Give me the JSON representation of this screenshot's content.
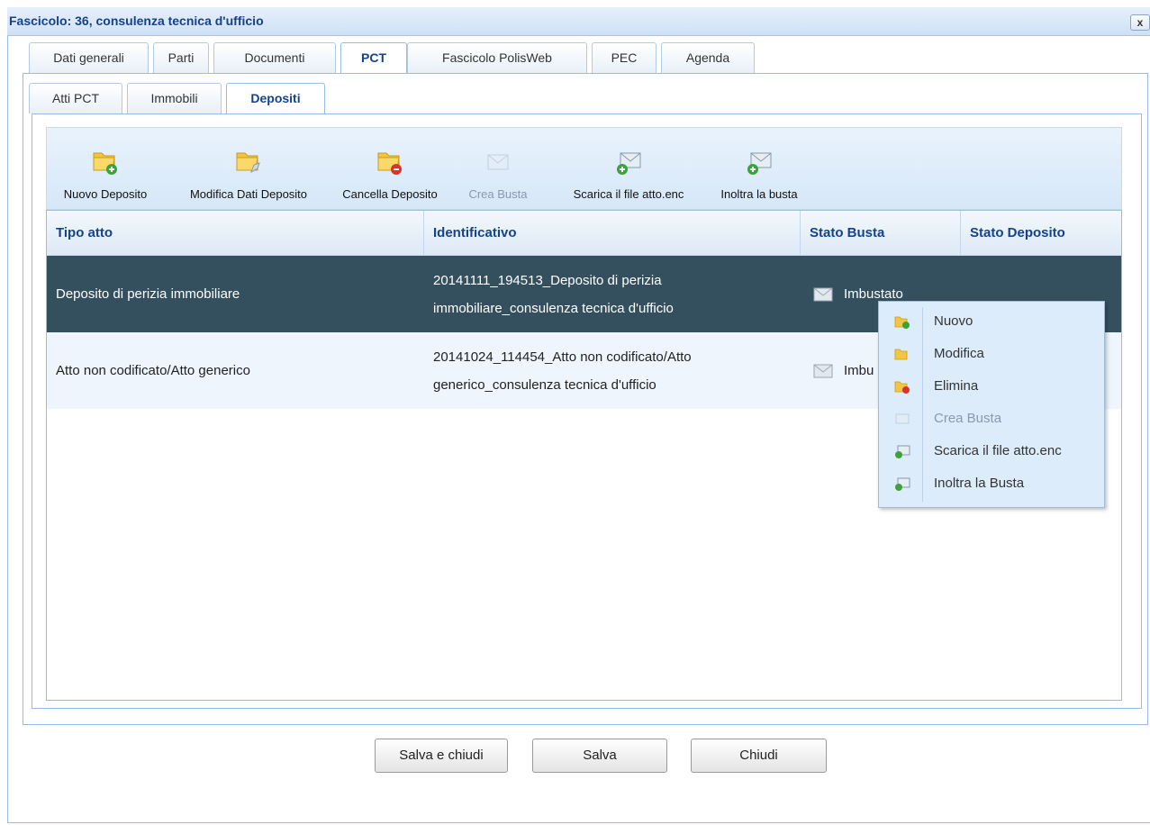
{
  "window": {
    "title": "Fascicolo: 36, consulenza tecnica d'ufficio",
    "close_label": "x"
  },
  "tabs": [
    {
      "label": "Dati generali",
      "active": false
    },
    {
      "label": "Parti",
      "active": false
    },
    {
      "label": "Documenti",
      "active": false
    },
    {
      "label": "PCT",
      "active": true
    },
    {
      "label": "Fascicolo PolisWeb",
      "active": false
    },
    {
      "label": "PEC",
      "active": false
    },
    {
      "label": "Agenda",
      "active": false
    }
  ],
  "subtabs": [
    {
      "label": "Atti PCT",
      "active": false
    },
    {
      "label": "Immobili",
      "active": false
    },
    {
      "label": "Depositi",
      "active": true
    }
  ],
  "toolbar": [
    {
      "label": "Nuovo Deposito",
      "icon": "folder-add-icon",
      "enabled": true
    },
    {
      "label": "Modifica Dati Deposito",
      "icon": "folder-edit-icon",
      "enabled": true
    },
    {
      "label": "Cancella Deposito",
      "icon": "folder-delete-icon",
      "enabled": true
    },
    {
      "label": "Crea Busta",
      "icon": "envelope-icon",
      "enabled": false
    },
    {
      "label": "Scarica il file atto.enc",
      "icon": "envelope-download-icon",
      "enabled": true
    },
    {
      "label": "Inoltra la busta",
      "icon": "envelope-send-icon",
      "enabled": true
    }
  ],
  "grid": {
    "columns": [
      "Tipo atto",
      "Identificativo",
      "Stato Busta",
      "Stato Deposito"
    ],
    "rows": [
      {
        "tipo_atto": "Deposito di perizia immobiliare",
        "identificativo_1": "20141111_194513_Deposito di perizia",
        "identificativo_2": "immobiliare_consulenza tecnica d'ufficio",
        "stato_busta": "Imbustato",
        "stato_deposito": "",
        "selected": true
      },
      {
        "tipo_atto": "Atto non codificato/Atto generico",
        "identificativo_1": "20141024_114454_Atto non codificato/Atto",
        "identificativo_2": "generico_consulenza tecnica d'ufficio",
        "stato_busta": "Imbu",
        "stato_deposito": "",
        "selected": false
      }
    ]
  },
  "context_menu": [
    {
      "label": "Nuovo",
      "icon": "folder-add-icon",
      "enabled": true
    },
    {
      "label": "Modifica",
      "icon": "folder-edit-icon",
      "enabled": true
    },
    {
      "label": "Elimina",
      "icon": "folder-delete-icon",
      "enabled": true
    },
    {
      "label": "Crea Busta",
      "icon": "envelope-icon",
      "enabled": false
    },
    {
      "label": "Scarica il file atto.enc",
      "icon": "envelope-download-icon",
      "enabled": true
    },
    {
      "label": "Inoltra la Busta",
      "icon": "envelope-send-icon",
      "enabled": true
    }
  ],
  "buttons": {
    "save_close": "Salva e chiudi",
    "save": "Salva",
    "close": "Chiudi"
  },
  "colors": {
    "accent": "#15428b",
    "selected_row": "#34505f",
    "folder": "#f2c641",
    "add_green": "#3aa33a",
    "delete_red": "#d9342b"
  }
}
